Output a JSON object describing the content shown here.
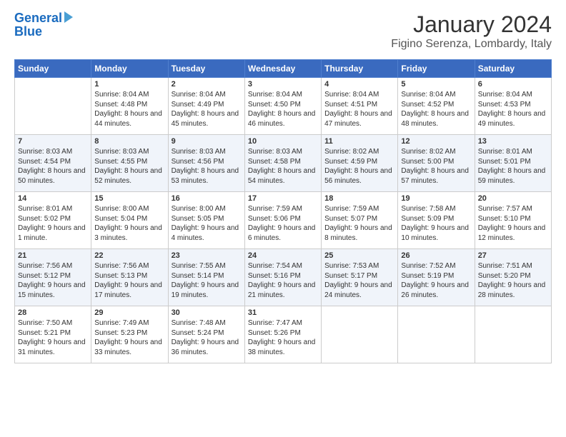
{
  "header": {
    "logo_line1": "General",
    "logo_line2": "Blue",
    "month_title": "January 2024",
    "location": "Figino Serenza, Lombardy, Italy"
  },
  "days_of_week": [
    "Sunday",
    "Monday",
    "Tuesday",
    "Wednesday",
    "Thursday",
    "Friday",
    "Saturday"
  ],
  "weeks": [
    [
      {
        "day": "",
        "sunrise": "",
        "sunset": "",
        "daylight": ""
      },
      {
        "day": "1",
        "sunrise": "Sunrise: 8:04 AM",
        "sunset": "Sunset: 4:48 PM",
        "daylight": "Daylight: 8 hours and 44 minutes."
      },
      {
        "day": "2",
        "sunrise": "Sunrise: 8:04 AM",
        "sunset": "Sunset: 4:49 PM",
        "daylight": "Daylight: 8 hours and 45 minutes."
      },
      {
        "day": "3",
        "sunrise": "Sunrise: 8:04 AM",
        "sunset": "Sunset: 4:50 PM",
        "daylight": "Daylight: 8 hours and 46 minutes."
      },
      {
        "day": "4",
        "sunrise": "Sunrise: 8:04 AM",
        "sunset": "Sunset: 4:51 PM",
        "daylight": "Daylight: 8 hours and 47 minutes."
      },
      {
        "day": "5",
        "sunrise": "Sunrise: 8:04 AM",
        "sunset": "Sunset: 4:52 PM",
        "daylight": "Daylight: 8 hours and 48 minutes."
      },
      {
        "day": "6",
        "sunrise": "Sunrise: 8:04 AM",
        "sunset": "Sunset: 4:53 PM",
        "daylight": "Daylight: 8 hours and 49 minutes."
      }
    ],
    [
      {
        "day": "7",
        "sunrise": "Sunrise: 8:03 AM",
        "sunset": "Sunset: 4:54 PM",
        "daylight": "Daylight: 8 hours and 50 minutes."
      },
      {
        "day": "8",
        "sunrise": "Sunrise: 8:03 AM",
        "sunset": "Sunset: 4:55 PM",
        "daylight": "Daylight: 8 hours and 52 minutes."
      },
      {
        "day": "9",
        "sunrise": "Sunrise: 8:03 AM",
        "sunset": "Sunset: 4:56 PM",
        "daylight": "Daylight: 8 hours and 53 minutes."
      },
      {
        "day": "10",
        "sunrise": "Sunrise: 8:03 AM",
        "sunset": "Sunset: 4:58 PM",
        "daylight": "Daylight: 8 hours and 54 minutes."
      },
      {
        "day": "11",
        "sunrise": "Sunrise: 8:02 AM",
        "sunset": "Sunset: 4:59 PM",
        "daylight": "Daylight: 8 hours and 56 minutes."
      },
      {
        "day": "12",
        "sunrise": "Sunrise: 8:02 AM",
        "sunset": "Sunset: 5:00 PM",
        "daylight": "Daylight: 8 hours and 57 minutes."
      },
      {
        "day": "13",
        "sunrise": "Sunrise: 8:01 AM",
        "sunset": "Sunset: 5:01 PM",
        "daylight": "Daylight: 8 hours and 59 minutes."
      }
    ],
    [
      {
        "day": "14",
        "sunrise": "Sunrise: 8:01 AM",
        "sunset": "Sunset: 5:02 PM",
        "daylight": "Daylight: 9 hours and 1 minute."
      },
      {
        "day": "15",
        "sunrise": "Sunrise: 8:00 AM",
        "sunset": "Sunset: 5:04 PM",
        "daylight": "Daylight: 9 hours and 3 minutes."
      },
      {
        "day": "16",
        "sunrise": "Sunrise: 8:00 AM",
        "sunset": "Sunset: 5:05 PM",
        "daylight": "Daylight: 9 hours and 4 minutes."
      },
      {
        "day": "17",
        "sunrise": "Sunrise: 7:59 AM",
        "sunset": "Sunset: 5:06 PM",
        "daylight": "Daylight: 9 hours and 6 minutes."
      },
      {
        "day": "18",
        "sunrise": "Sunrise: 7:59 AM",
        "sunset": "Sunset: 5:07 PM",
        "daylight": "Daylight: 9 hours and 8 minutes."
      },
      {
        "day": "19",
        "sunrise": "Sunrise: 7:58 AM",
        "sunset": "Sunset: 5:09 PM",
        "daylight": "Daylight: 9 hours and 10 minutes."
      },
      {
        "day": "20",
        "sunrise": "Sunrise: 7:57 AM",
        "sunset": "Sunset: 5:10 PM",
        "daylight": "Daylight: 9 hours and 12 minutes."
      }
    ],
    [
      {
        "day": "21",
        "sunrise": "Sunrise: 7:56 AM",
        "sunset": "Sunset: 5:12 PM",
        "daylight": "Daylight: 9 hours and 15 minutes."
      },
      {
        "day": "22",
        "sunrise": "Sunrise: 7:56 AM",
        "sunset": "Sunset: 5:13 PM",
        "daylight": "Daylight: 9 hours and 17 minutes."
      },
      {
        "day": "23",
        "sunrise": "Sunrise: 7:55 AM",
        "sunset": "Sunset: 5:14 PM",
        "daylight": "Daylight: 9 hours and 19 minutes."
      },
      {
        "day": "24",
        "sunrise": "Sunrise: 7:54 AM",
        "sunset": "Sunset: 5:16 PM",
        "daylight": "Daylight: 9 hours and 21 minutes."
      },
      {
        "day": "25",
        "sunrise": "Sunrise: 7:53 AM",
        "sunset": "Sunset: 5:17 PM",
        "daylight": "Daylight: 9 hours and 24 minutes."
      },
      {
        "day": "26",
        "sunrise": "Sunrise: 7:52 AM",
        "sunset": "Sunset: 5:19 PM",
        "daylight": "Daylight: 9 hours and 26 minutes."
      },
      {
        "day": "27",
        "sunrise": "Sunrise: 7:51 AM",
        "sunset": "Sunset: 5:20 PM",
        "daylight": "Daylight: 9 hours and 28 minutes."
      }
    ],
    [
      {
        "day": "28",
        "sunrise": "Sunrise: 7:50 AM",
        "sunset": "Sunset: 5:21 PM",
        "daylight": "Daylight: 9 hours and 31 minutes."
      },
      {
        "day": "29",
        "sunrise": "Sunrise: 7:49 AM",
        "sunset": "Sunset: 5:23 PM",
        "daylight": "Daylight: 9 hours and 33 minutes."
      },
      {
        "day": "30",
        "sunrise": "Sunrise: 7:48 AM",
        "sunset": "Sunset: 5:24 PM",
        "daylight": "Daylight: 9 hours and 36 minutes."
      },
      {
        "day": "31",
        "sunrise": "Sunrise: 7:47 AM",
        "sunset": "Sunset: 5:26 PM",
        "daylight": "Daylight: 9 hours and 38 minutes."
      },
      {
        "day": "",
        "sunrise": "",
        "sunset": "",
        "daylight": ""
      },
      {
        "day": "",
        "sunrise": "",
        "sunset": "",
        "daylight": ""
      },
      {
        "day": "",
        "sunrise": "",
        "sunset": "",
        "daylight": ""
      }
    ]
  ]
}
